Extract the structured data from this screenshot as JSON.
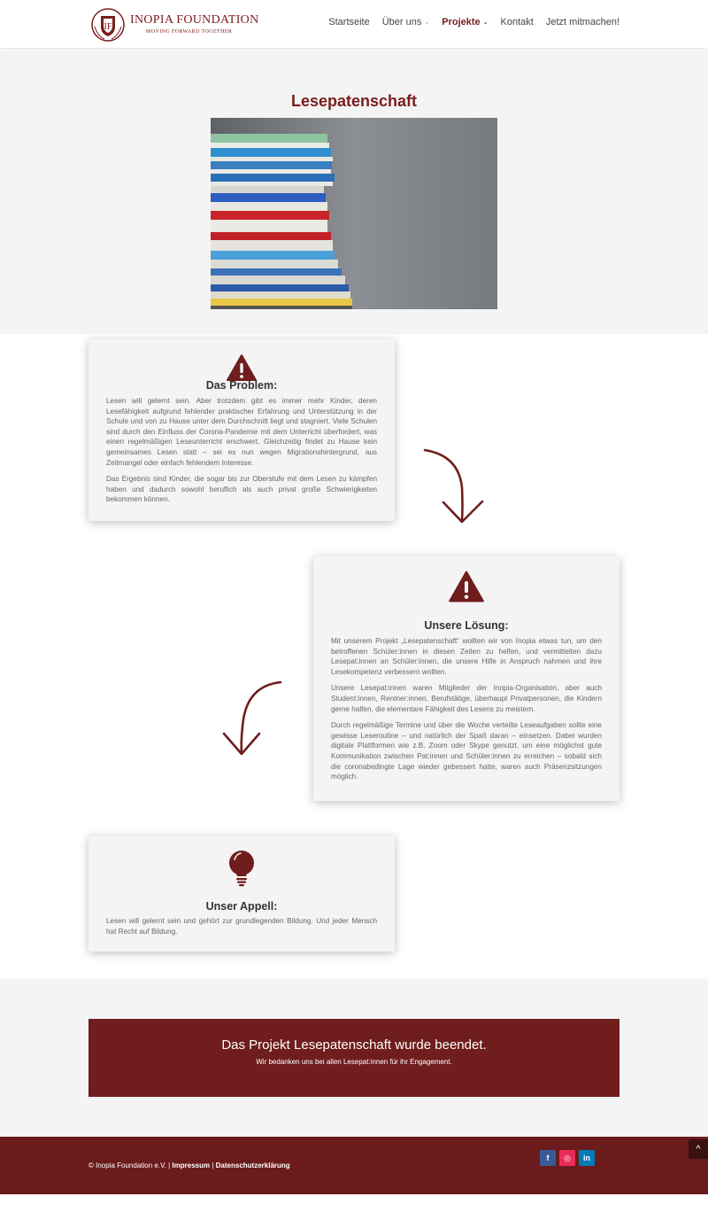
{
  "header": {
    "logo_title": "INOPIA FOUNDATION",
    "logo_subtitle": "MOVING FORWARD TOGETHER",
    "nav": [
      {
        "label": "Startseite"
      },
      {
        "label": "Über uns"
      },
      {
        "label": "Projekte"
      },
      {
        "label": "Kontakt"
      },
      {
        "label": "Jetzt mitmachen!"
      }
    ]
  },
  "hero": {
    "title": "Lesepatenschaft"
  },
  "cards": {
    "problem": {
      "title": "Das Problem:",
      "paragraphs": [
        "Lesen will gelernt sein. Aber trotzdem gibt es immer mehr Kinder, deren Lesefähigkeit aufgrund fehlender praktischer Erfahrung und Unterstützung in der Schule und von zu Hause unter dem Durchschnitt liegt und stagniert. Viele Schulen sind durch den Einfluss der Corona-Pandemie mit dem Unterricht überfordert, was einen regelmäßigen Leseunterricht erschwert. Gleichzeitig findet zu Hause kein gemeinsames Lesen statt – sei es nun wegen Migrationshintergrund, aus Zeitmangel oder einfach fehlendem Interesse.",
        "Das Ergebnis sind Kinder, die sogar bis zur Oberstufe mit dem Lesen zu kämpfen haben und dadurch sowohl beruflich als auch privat große Schwierigkeiten bekommen können."
      ]
    },
    "solution": {
      "title": "Unsere Lösung:",
      "paragraphs": [
        "Mit unserem Projekt „Lesepatenschaft“ wollten wir von Inopia etwas tun, um den betroffenen Schüler:innen in diesen Zeiten zu helfen, und vermittelten dazu Lesepat:innen an Schüler:innen, die unsere Hilfe in Anspruch nahmen und ihre Lesekompetenz verbessern wollten.",
        "Unsere Lesepat:innen waren Mitglieder der Inopia-Organisation, aber auch Student:innen, Rentner:innen, Berufstätige, überhaupt Privatpersonen, die Kindern gerne halfen, die elementare Fähigkeit des Lesens zu meistern.",
        "Durch regelmäßige Termine und über die Woche verteilte Leseaufgaben sollte eine gewisse Leseroutine – und natürlich der Spaß daran – einsetzen. Dabei wurden digitale Plattformen wie z.B. Zoom oder Skype genutzt, um eine möglichst gute Kommunikation zwischen Pat:innen und Schüler:innen zu erreichen – sobald sich die coronabedingte Lage wieder gebessert hatte, waren auch Präsenzsitzungen möglich."
      ]
    },
    "appeal": {
      "title": "Unser Appell:",
      "paragraphs": [
        "Lesen will gelernt sein und gehört zur grundlegenden Bildung. Und jeder Mensch hat Recht auf Bildung."
      ]
    }
  },
  "banner": {
    "title": "Das Projekt Lesepatenschaft wurde beendet.",
    "subtitle": "Wir bedanken uns bei allen Lesepat:innen für ihr Engagement."
  },
  "footer": {
    "copyright": "© Inopia Foundation e.V. | ",
    "impressum": "Impressum",
    "separator": " | ",
    "privacy": "Datenschutzerklärung",
    "social": [
      {
        "label": "f",
        "icon": "facebook-icon"
      },
      {
        "label": "◎",
        "icon": "instagram-icon"
      },
      {
        "label": "in",
        "icon": "linkedin-icon"
      }
    ],
    "to_top": "^"
  },
  "colors": {
    "brand": "#7a1e1e",
    "banner": "#701d1d",
    "footer": "#6b1b1b",
    "section_grey": "#f4f4f4"
  }
}
